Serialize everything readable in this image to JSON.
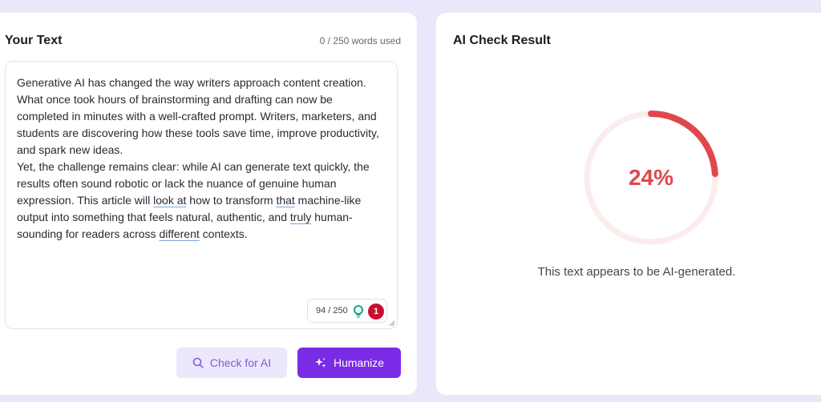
{
  "left_panel": {
    "title": "Your Text",
    "words_used": "0 / 250 words used",
    "paragraph1_lines": [
      "Generative AI has changed the way writers approach content creation.",
      "What once took hours of brainstorming and drafting can now be",
      "completed in minutes with a well-crafted prompt. Writers, marketers, and",
      "students are discovering how these tools save time, improve productivity,",
      "and spark new ideas."
    ],
    "p2_l1": "Yet, the challenge remains clear: while AI can generate text quickly, the",
    "p2_l2": "results often sound robotic or lack the nuance of genuine human",
    "p2_l3a": "expression. This article will ",
    "p2_l3b": "look at",
    "p2_l3c": " how to transform ",
    "p2_l3d": "that",
    "p2_l3e": " machine-like",
    "p2_l4a": "output into something that feels natural, authentic, and ",
    "p2_l4b": "truly",
    "p2_l4c": " human-",
    "p2_l5a": "sounding for readers across ",
    "p2_l5b": "different",
    "p2_l5c": " contexts.",
    "counter": "94 / 250",
    "error_count": "1"
  },
  "buttons": {
    "check_label": "Check for AI",
    "humanize_label": "Humanize"
  },
  "right_panel": {
    "title": "AI Check Result",
    "percent_label": "24%",
    "ai_probability": 0.24,
    "message": "This text appears to be AI-generated."
  },
  "colors": {
    "accent": "#7a2be6",
    "gauge_fill": "#e0474c",
    "gauge_track": "#fcecec"
  }
}
